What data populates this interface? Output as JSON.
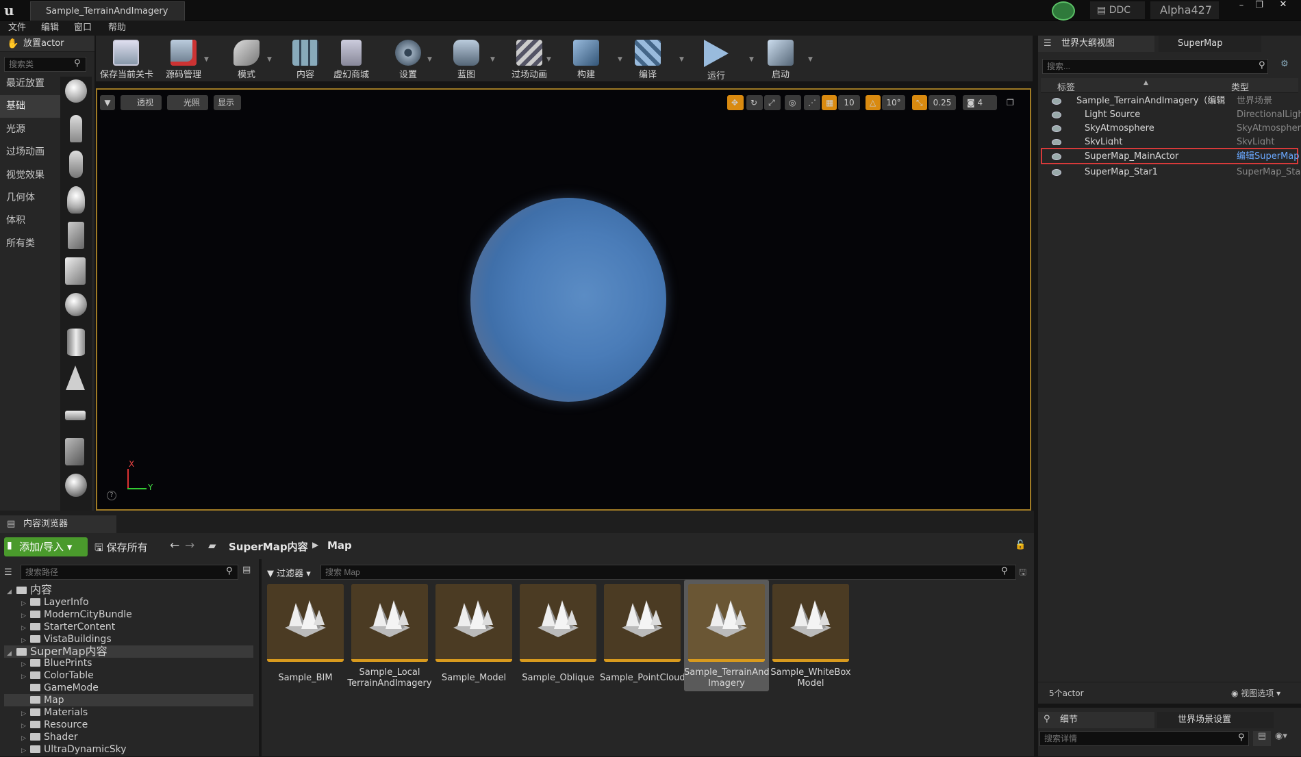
{
  "window": {
    "title": "Sample_TerrainAndImagery",
    "ddc": "DDC",
    "user": "Alpha427"
  },
  "menu": [
    "文件",
    "编辑",
    "窗口",
    "帮助"
  ],
  "place_actor": {
    "tab": "放置actor",
    "search_placeholder": "搜索类",
    "categories": [
      "最近放置",
      "基础",
      "光源",
      "过场动画",
      "视觉效果",
      "几何体",
      "体积",
      "所有类"
    ],
    "active": "基础"
  },
  "toolbar": [
    {
      "label": "保存当前关卡",
      "icon": "save-icon"
    },
    {
      "label": "源码管理",
      "icon": "source-control-icon"
    },
    {
      "label": "模式",
      "icon": "modes-icon"
    },
    {
      "label": "内容",
      "icon": "content-icon"
    },
    {
      "label": "虚幻商城",
      "icon": "marketplace-icon"
    },
    {
      "label": "设置",
      "icon": "settings-icon"
    },
    {
      "label": "蓝图",
      "icon": "blueprint-icon"
    },
    {
      "label": "过场动画",
      "icon": "cinematics-icon"
    },
    {
      "label": "构建",
      "icon": "build-icon"
    },
    {
      "label": "编译",
      "icon": "compile-icon"
    },
    {
      "label": "运行",
      "icon": "play-icon"
    },
    {
      "label": "启动",
      "icon": "launch-icon"
    }
  ],
  "viewport": {
    "perspective": "透视",
    "lit": "光照",
    "show": "显示",
    "grid_snap": "10",
    "rot_snap": "10°",
    "scale_snap": "0.25",
    "camera_speed": "4",
    "axis_x": "X",
    "axis_y": "Y"
  },
  "outliner": {
    "tab": "世界大纲视图",
    "tab2": "SuperMap",
    "search_placeholder": "搜索...",
    "col_label": "标签",
    "col_type": "类型",
    "rows": [
      {
        "name": "Sample_TerrainAndImagery（编辑",
        "type": "世界场景"
      },
      {
        "name": "Light Source",
        "type": "DirectionalLight"
      },
      {
        "name": "SkyAtmosphere",
        "type": "SkyAtmosphere"
      },
      {
        "name": "SkyLight",
        "type": "SkyLight"
      },
      {
        "name": "SuperMap_MainActor",
        "type": "编辑SuperMap"
      },
      {
        "name": "SuperMap_Star1",
        "type": "SuperMap_Star"
      }
    ],
    "count": "5个actor",
    "view_options": "视图选项"
  },
  "details": {
    "tab": "细节",
    "tab2": "世界场景设置",
    "search_placeholder": "搜索详情"
  },
  "content_browser": {
    "tab": "内容浏览器",
    "add_import": "添加/导入",
    "save_all": "保存所有",
    "breadcrumb": [
      "SuperMap内容",
      "Map"
    ],
    "path_placeholder": "搜索路径",
    "filter": "过滤器",
    "search_placeholder": "搜索 Map",
    "tree": [
      {
        "label": "内容",
        "level": 0
      },
      {
        "label": "LayerInfo",
        "level": 1
      },
      {
        "label": "ModernCityBundle",
        "level": 1
      },
      {
        "label": "StarterContent",
        "level": 1
      },
      {
        "label": "VistaBuildings",
        "level": 1
      },
      {
        "label": "SuperMap内容",
        "level": 0
      },
      {
        "label": "BluePrints",
        "level": 1
      },
      {
        "label": "ColorTable",
        "level": 1
      },
      {
        "label": "GameMode",
        "level": 1
      },
      {
        "label": "Map",
        "level": 1
      },
      {
        "label": "Materials",
        "level": 1
      },
      {
        "label": "Resource",
        "level": 1
      },
      {
        "label": "Shader",
        "level": 1
      },
      {
        "label": "UltraDynamicSky",
        "level": 1
      }
    ],
    "assets": [
      {
        "l1": "Sample_BIM",
        "l2": ""
      },
      {
        "l1": "Sample_Local",
        "l2": "TerrainAndImagery"
      },
      {
        "l1": "Sample_Model",
        "l2": ""
      },
      {
        "l1": "Sample_Oblique",
        "l2": ""
      },
      {
        "l1": "Sample_PointCloud",
        "l2": ""
      },
      {
        "l1": "Sample_TerrainAnd",
        "l2": "Imagery"
      },
      {
        "l1": "Sample_WhiteBox",
        "l2": "Model"
      }
    ]
  }
}
